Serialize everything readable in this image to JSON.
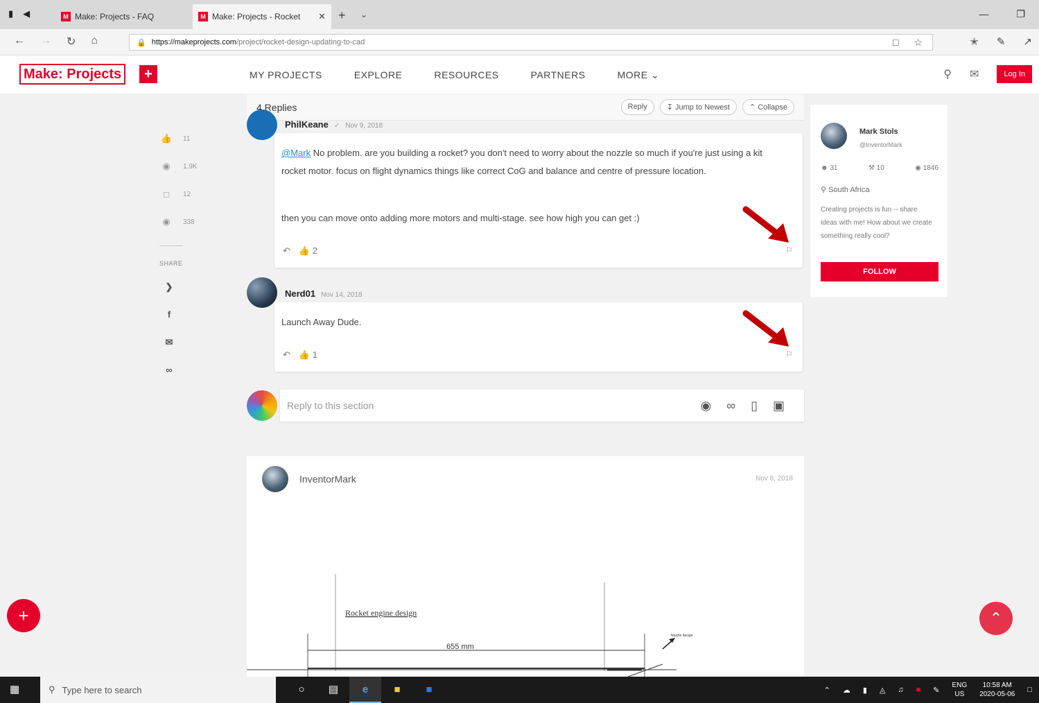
{
  "browser": {
    "tabs": [
      {
        "title": "Make: Projects - FAQ",
        "favicon": "M"
      },
      {
        "title": "Make: Projects - Rocket",
        "favicon": "M"
      }
    ],
    "url_host": "https://makeprojects.com",
    "url_path": "/project/rocket-design-updating-to-cad"
  },
  "site": {
    "logo": "Make: Projects",
    "nav": [
      "MY PROJECTS",
      "EXPLORE",
      "RESOURCES",
      "PARTNERS",
      "MORE"
    ],
    "login_label": "Log In",
    "accent": "#e4002b"
  },
  "rail": {
    "stats": [
      {
        "icon": "thumbs-up-icon",
        "value": "11"
      },
      {
        "icon": "globe-icon",
        "value": "1.9K"
      },
      {
        "icon": "comment-icon",
        "value": "12"
      },
      {
        "icon": "eye-icon",
        "value": "338"
      }
    ],
    "share_label": "SHARE"
  },
  "thread": {
    "replies_label": "4 Replies",
    "reply_btn": "Reply",
    "jump_btn": "Jump to Newest",
    "collapse_btn": "Collapse",
    "comments": [
      {
        "author": "PhilKeane",
        "date": "Nov 9, 2018",
        "mention": "@Mark",
        "p1": "No problem. are you building a rocket? you don't need to worry about the nozzle so much if you're just using a kit rocket motor. focus on flight dynamics things like correct CoG and balance and centre of pressure location.",
        "p2": "then you can move onto adding more motors and multi-stage. see how high you can get :)",
        "likes": "2"
      },
      {
        "author": "Nerd01",
        "date": "Nov 14, 2018",
        "p1": "Launch Away Dude.",
        "likes": "1"
      }
    ],
    "reply_placeholder": "Reply to this section"
  },
  "profile": {
    "name": "Mark Stols",
    "handle": "@InventorMark",
    "followers": "31",
    "projects": "10",
    "views": "1846",
    "location": "South Africa",
    "bio": "Creating projects is fun -- share ideas with me! How about we create something really cool?",
    "follow_label": "FOLLOW"
  },
  "post": {
    "author": "InventorMark",
    "date": "Nov 8, 2018",
    "drawing_title": "Rocket engine design",
    "drawing_dim": "655 mm",
    "drawing_note": "Nozzle design"
  },
  "taskbar": {
    "search_placeholder": "Type here to search",
    "lang": "ENG",
    "region": "US",
    "time": "10:58 AM",
    "date": "2020-05-06"
  }
}
